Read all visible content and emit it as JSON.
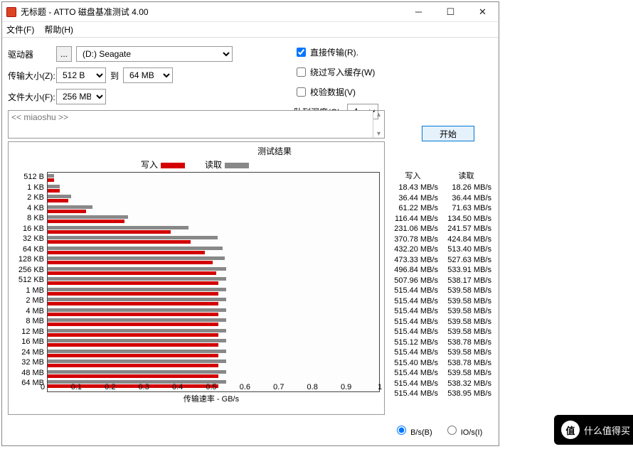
{
  "title": "无标题 - ATTO 磁盘基准测试 4.00",
  "menu": {
    "file": "文件(F)",
    "help": "帮助(H)"
  },
  "config": {
    "drive_lbl": "驱动器",
    "drive_btn": "...",
    "drive_val": "(D:) Seagate",
    "xfer_lbl": "传输大小(Z):",
    "xfer_from": "512 B",
    "xfer_to_lbl": "到",
    "xfer_to": "64 MB",
    "file_lbl": "文件大小(F):",
    "file_val": "256 MB"
  },
  "options": {
    "direct": "直接传输(R).",
    "bypass": "绕过写入缓存(W)",
    "verify": "校验数据(V)",
    "qdepth_lbl": "队列深度(Q):",
    "qdepth_val": "4",
    "start": "开始"
  },
  "desc_placeholder": "<< miaoshu >>",
  "results_title": "测试结果",
  "legend": {
    "write": "写入",
    "read": "读取"
  },
  "cols": {
    "write": "写入",
    "read": "读取"
  },
  "unit": " MB/s",
  "xlabel": "传输速率 - GB/s",
  "xticks": [
    "0",
    "0.1",
    "0.2",
    "0.3",
    "0.4",
    "0.5",
    "0.6",
    "0.7",
    "0.8",
    "0.9",
    "1"
  ],
  "radios": {
    "bs": "B/s(B)",
    "ios": "IO/s(I)"
  },
  "watermark": "什么值得买",
  "chart_data": {
    "type": "bar",
    "title": "测试结果",
    "xlabel": "传输速率 - GB/s",
    "ylabel": "",
    "xlim": [
      0,
      1
    ],
    "categories": [
      "512 B",
      "1 KB",
      "2 KB",
      "4 KB",
      "8 KB",
      "16 KB",
      "32 KB",
      "64 KB",
      "128 KB",
      "256 KB",
      "512 KB",
      "1 MB",
      "2 MB",
      "4 MB",
      "8 MB",
      "12 MB",
      "16 MB",
      "24 MB",
      "32 MB",
      "48 MB",
      "64 MB"
    ],
    "series": [
      {
        "name": "写入",
        "values": [
          18.43,
          36.44,
          61.22,
          116.44,
          231.06,
          370.78,
          432.2,
          473.33,
          496.84,
          507.96,
          515.44,
          515.44,
          515.44,
          515.44,
          515.44,
          515.12,
          515.44,
          515.4,
          515.44,
          515.44,
          515.44
        ]
      },
      {
        "name": "读取",
        "values": [
          18.26,
          36.44,
          71.63,
          134.5,
          241.57,
          424.84,
          513.4,
          527.63,
          533.91,
          538.17,
          539.58,
          539.58,
          539.58,
          539.58,
          539.58,
          538.78,
          539.58,
          538.78,
          539.58,
          538.32,
          538.95
        ]
      }
    ]
  }
}
